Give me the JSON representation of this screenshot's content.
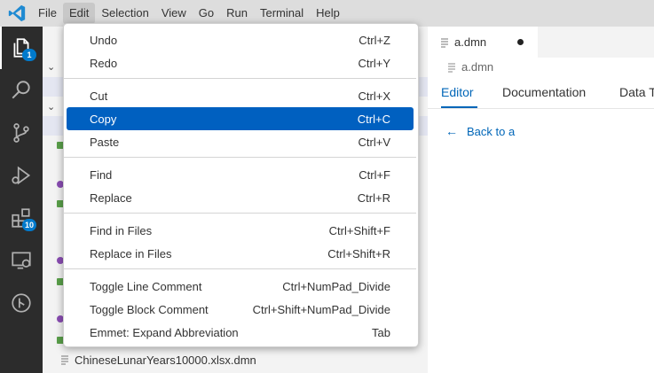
{
  "menubar": {
    "items": [
      "File",
      "Edit",
      "Selection",
      "View",
      "Go",
      "Run",
      "Terminal",
      "Help"
    ],
    "active_index": 1
  },
  "activity_bar": {
    "explorer_badge": "1",
    "extensions_badge": "10",
    "icons": [
      "files-icon",
      "search-icon",
      "source-control-icon",
      "run-debug-icon",
      "extensions-icon",
      "remote-explorer-icon",
      "git-graph-icon"
    ]
  },
  "sidebar": {
    "file_name": "ChineseLunarYears10000.xlsx.dmn"
  },
  "editor": {
    "tab_label": "a.dmn",
    "breadcrumb": "a.dmn",
    "inner_tabs": [
      "Editor",
      "Documentation",
      "Data T"
    ],
    "back_link": "Back to a"
  },
  "edit_menu": {
    "items": [
      {
        "label": "Undo",
        "key": "Ctrl+Z"
      },
      {
        "label": "Redo",
        "key": "Ctrl+Y"
      },
      {
        "label": "Cut",
        "key": "Ctrl+X"
      },
      {
        "label": "Copy",
        "key": "Ctrl+C"
      },
      {
        "label": "Paste",
        "key": "Ctrl+V"
      },
      {
        "label": "Find",
        "key": "Ctrl+F"
      },
      {
        "label": "Replace",
        "key": "Ctrl+R"
      },
      {
        "label": "Find in Files",
        "key": "Ctrl+Shift+F"
      },
      {
        "label": "Replace in Files",
        "key": "Ctrl+Shift+R"
      },
      {
        "label": "Toggle Line Comment",
        "key": "Ctrl+NumPad_Divide"
      },
      {
        "label": "Toggle Block Comment",
        "key": "Ctrl+Shift+NumPad_Divide"
      },
      {
        "label": "Emmet: Expand Abbreviation",
        "key": "Tab"
      }
    ],
    "selected_index": 3
  },
  "colors": {
    "accent": "#0066b8",
    "menu_selection": "#0060c0",
    "activity_bar": "#2c2c2c",
    "badge": "#007acc"
  }
}
